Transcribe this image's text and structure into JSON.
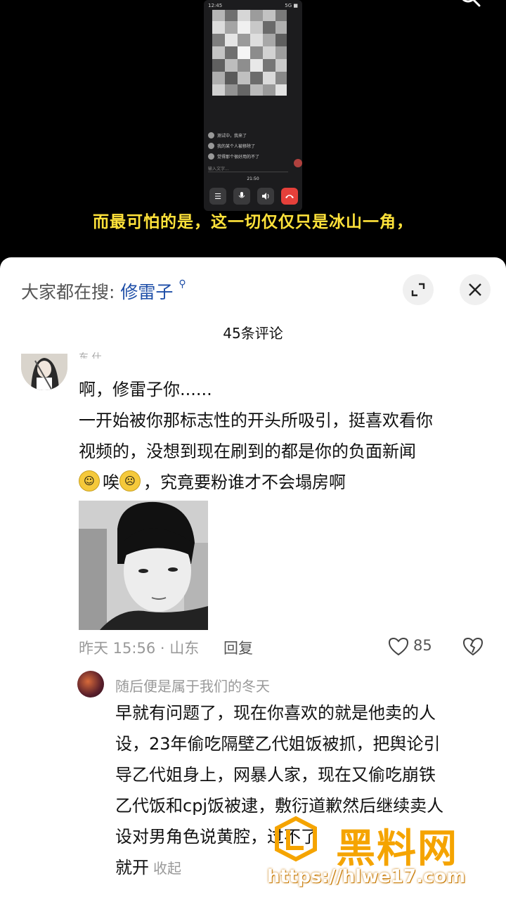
{
  "video": {
    "status_time": "12:45",
    "status_right": "5G ■",
    "comments": [
      "测试中，我来了",
      "我的某个人被移除了",
      "觉得那个很好用的不了"
    ],
    "input_placeholder": "输入文字...",
    "call_timer": "21:50",
    "subtitle": "而最可怕的是，这一切仅仅只是冰山一角，"
  },
  "sheet": {
    "search_prefix": "大家都在搜:",
    "search_keyword": "修雷子",
    "comment_count": "45条评论",
    "top_comment": {
      "author_partial": "东 仕",
      "line1": "啊，修雷子你......",
      "line2": "一开始被你那标志性的开头所吸引，挺喜欢看你",
      "line3": "视频的，没想到现在刷到的都是你的负面新闻",
      "line4_text1": "唉",
      "line4_text2": "，究竟要粉谁才不会塌房啊",
      "meta": "昨天 15:56 · 山东",
      "reply_label": "回复",
      "likes": "85"
    },
    "reply": {
      "author": "随后便是属于我们的冬天",
      "lines": [
        "早就有问题了，现在你喜欢的就是他卖的人",
        "设，23年偷吃隔壁乙代姐饭被抓，把舆论引",
        "导乙代姐身上，网暴人家，现在又偷吃崩铁",
        "乙代饭和cpj饭被逮，敷衍道歉然后继续卖人",
        "设对男角色说黄腔，过不了"
      ],
      "last_line": "就开",
      "collapse_label": "收起"
    }
  },
  "watermark": {
    "brand": "黑料网",
    "url": "https://hlwe17.com"
  },
  "colors": {
    "subtitle": "#ffe23a",
    "link": "#1f4fa8",
    "watermark": "#f5a400"
  }
}
